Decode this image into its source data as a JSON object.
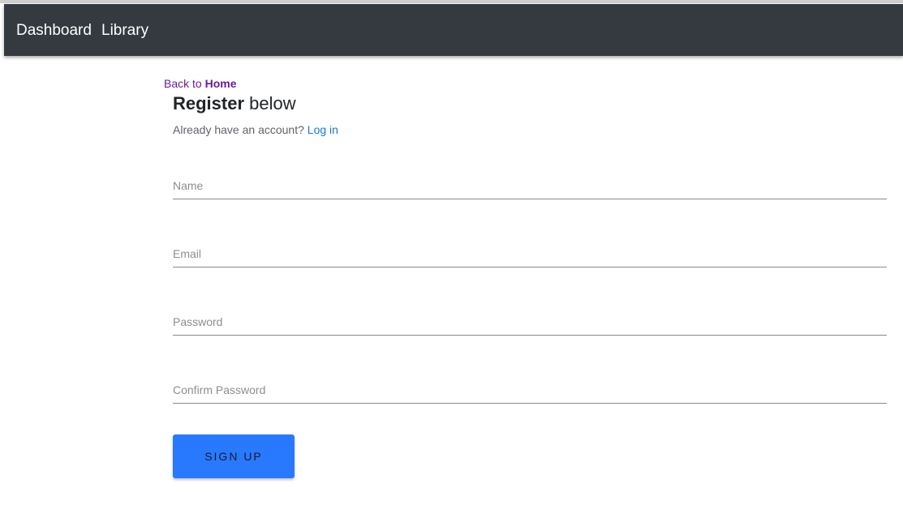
{
  "navbar": {
    "dashboard_label": "Dashboard",
    "library_label": "Library"
  },
  "back": {
    "prefix": "Back to",
    "home_label": "Home"
  },
  "heading": {
    "strong": "Register",
    "rest": "below"
  },
  "login_prompt": {
    "text": "Already have an account?",
    "link_label": "Log in"
  },
  "form": {
    "name_placeholder": "Name",
    "email_placeholder": "Email",
    "password_placeholder": "Password",
    "confirm_placeholder": "Confirm Password",
    "submit_label": "SIGN UP"
  },
  "colors": {
    "navbar_bg": "#343a40",
    "accent": "#2979ff",
    "back_link": "#6a1b9a",
    "login_link": "#1976d2"
  }
}
